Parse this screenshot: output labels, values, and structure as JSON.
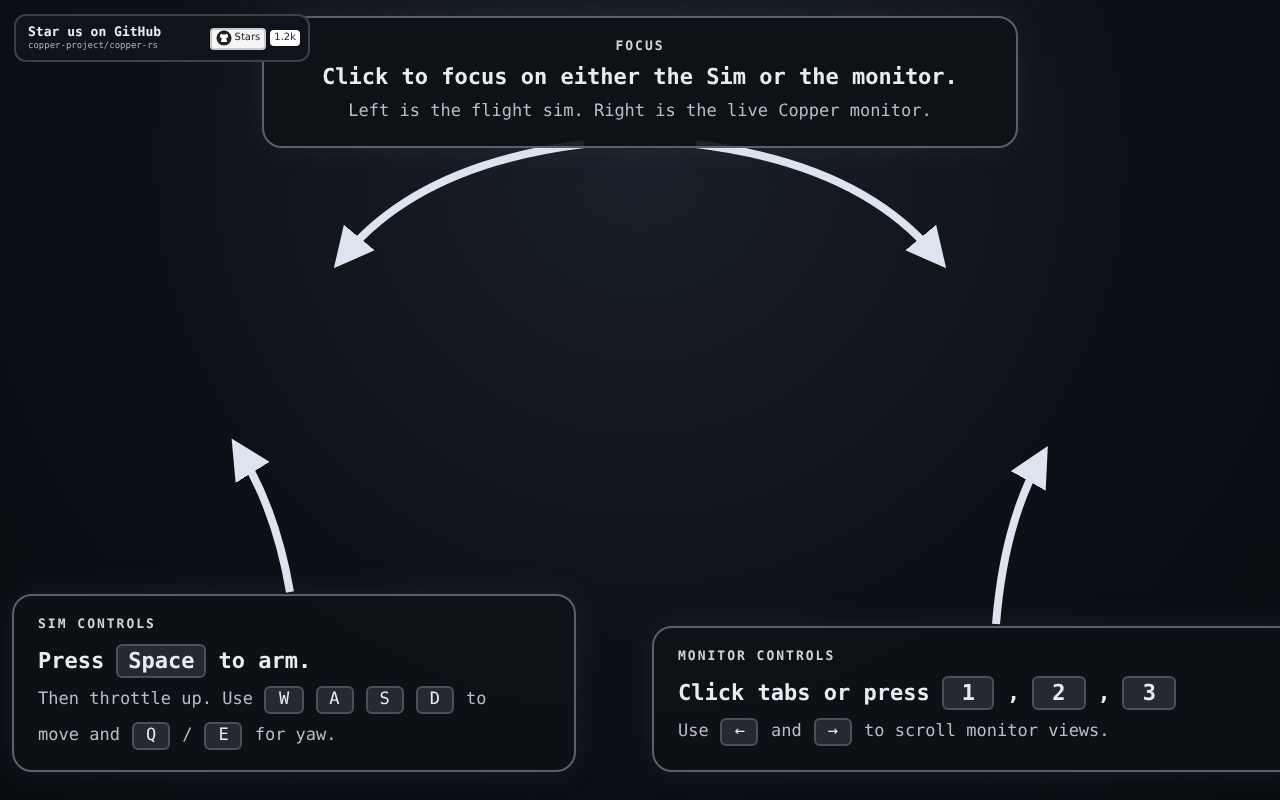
{
  "github_badge": {
    "title": "Star us on GitHub",
    "repo": "copper-project/copper-rs",
    "button": "Stars",
    "count": "1.2k"
  },
  "focus_card": {
    "heading": "FOCUS",
    "title": "Click to focus on either the Sim or the monitor.",
    "subtitle": "Left is the flight sim. Right is the live Copper monitor."
  },
  "sim_card": {
    "heading": "SIM CONTROLS",
    "lines": [
      {
        "kind": "title",
        "parts": [
          {
            "kind": "text",
            "text": "Press"
          },
          {
            "kind": "key",
            "text": "Space"
          },
          {
            "kind": "text",
            "text": "to arm."
          }
        ]
      },
      {
        "kind": "body",
        "parts": [
          {
            "kind": "text",
            "text": "Then throttle up. Use"
          },
          {
            "kind": "key",
            "text": "W"
          },
          {
            "kind": "key",
            "text": "A"
          },
          {
            "kind": "key",
            "text": "S"
          },
          {
            "kind": "key",
            "text": "D"
          },
          {
            "kind": "text",
            "text": "to"
          }
        ]
      },
      {
        "kind": "body",
        "parts": [
          {
            "kind": "text",
            "text": "move and"
          },
          {
            "kind": "key",
            "text": "Q"
          },
          {
            "kind": "text",
            "text": "/"
          },
          {
            "kind": "key",
            "text": "E"
          },
          {
            "kind": "text",
            "text": "for yaw."
          }
        ]
      }
    ]
  },
  "monitor_card": {
    "heading": "MONITOR CONTROLS",
    "lines": [
      {
        "kind": "title",
        "parts": [
          {
            "kind": "text",
            "text": "Click tabs or press"
          },
          {
            "kind": "key",
            "text": "1"
          },
          {
            "kind": "text",
            "text": ","
          },
          {
            "kind": "key",
            "text": "2"
          },
          {
            "kind": "text",
            "text": ","
          },
          {
            "kind": "key",
            "text": "3"
          }
        ]
      },
      {
        "kind": "body",
        "parts": [
          {
            "kind": "text",
            "text": "Use"
          },
          {
            "kind": "key",
            "text": "←"
          },
          {
            "kind": "text",
            "text": "and"
          },
          {
            "kind": "key",
            "text": "→"
          },
          {
            "kind": "text",
            "text": "to scroll monitor views."
          }
        ]
      }
    ]
  }
}
